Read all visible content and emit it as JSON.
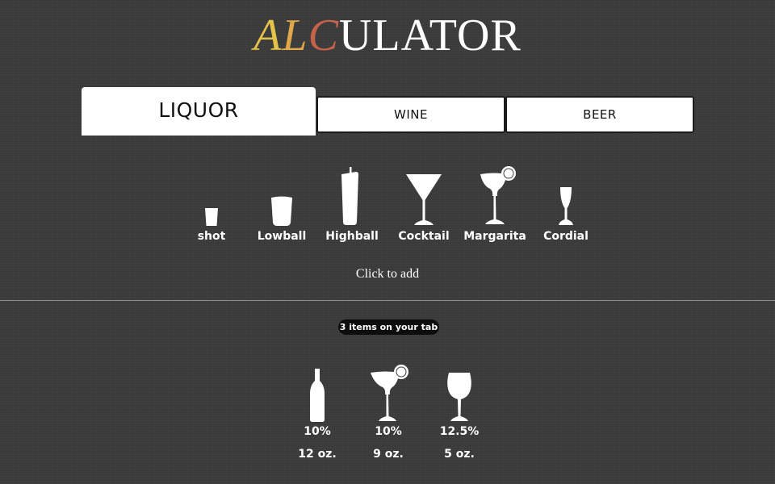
{
  "app": {
    "title_part1": "A",
    "title_part2": "L",
    "title_part3": "C",
    "title_rest": "ULATOR"
  },
  "tabs": [
    {
      "label": "LIQUOR",
      "active": true
    },
    {
      "label": "WINE",
      "active": false
    },
    {
      "label": "BEER",
      "active": false
    }
  ],
  "drinks": [
    {
      "label": "shot",
      "icon": "shot-glass-icon"
    },
    {
      "label": "Lowball",
      "icon": "lowball-glass-icon"
    },
    {
      "label": "Highball",
      "icon": "highball-glass-icon"
    },
    {
      "label": "Cocktail",
      "icon": "cocktail-glass-icon"
    },
    {
      "label": "Margarita",
      "icon": "margarita-glass-icon"
    },
    {
      "label": "Cordial",
      "icon": "cordial-glass-icon"
    }
  ],
  "hint": "Click to add",
  "tab_count": "3 items on your tab",
  "tab_items": [
    {
      "abv": "10%",
      "volume": "12 oz.",
      "icon": "beer-bottle-icon"
    },
    {
      "abv": "10%",
      "volume": "9 oz.",
      "icon": "margarita-glass-icon"
    },
    {
      "abv": "12.5%",
      "volume": "5 oz.",
      "icon": "wine-glass-icon"
    }
  ],
  "colors": {
    "background": "#3c3c3c",
    "title_a": "#e5c24a",
    "title_l": "#e1a84a",
    "title_c": "#c5624a",
    "badge": "#0d0d0d",
    "icon": "#ffffff"
  }
}
